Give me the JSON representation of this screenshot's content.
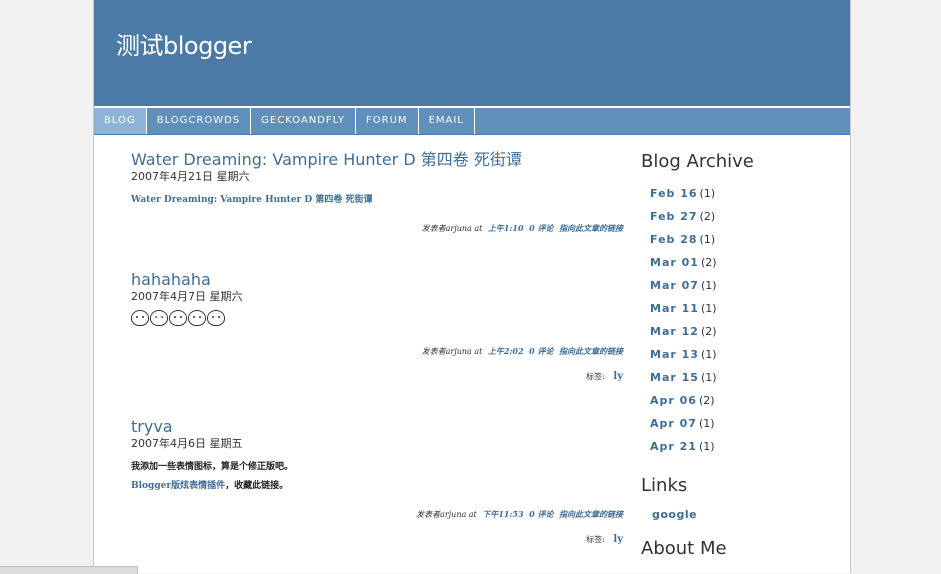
{
  "header": {
    "title": "测试blogger"
  },
  "nav": [
    "BLOG",
    "BLOGCROWDS",
    "GECKOANDFLY",
    "FORUM",
    "EMAIL"
  ],
  "posts": [
    {
      "title": "Water Dreaming: Vampire Hunter D 第四卷 死街谭",
      "date": "2007年4月21日 星期六",
      "body_link": "Water Dreaming: Vampire Hunter D 第四卷 死街谭",
      "footer_prefix": "发表者arjuna at",
      "time": "上午1:10",
      "comments": "0 评论",
      "permalink": "指向此文章的链接"
    },
    {
      "title": "hahahaha",
      "date": "2007年4月7日 星期六",
      "footer_prefix": "发表者arjuna at",
      "time": "上午2:02",
      "comments": "0 评论",
      "permalink": "指向此文章的链接",
      "labels_prefix": "标签:",
      "label": "ly"
    },
    {
      "title": "tryva",
      "date": "2007年4月6日 星期五",
      "body_text": "我添加一些表情图标，算是个修正版吧。",
      "body_link": "Blogger版炫表情插件",
      "body_text_after": "，收藏此链接。",
      "footer_prefix": "发表者arjuna at",
      "time": "下午11:53",
      "comments": "0 评论",
      "permalink": "指向此文章的链接",
      "labels_prefix": "标签:",
      "label": "ly"
    }
  ],
  "sidebar": {
    "archive_title": "Blog Archive",
    "archive": [
      {
        "date": "Feb 16",
        "count": "(1)"
      },
      {
        "date": "Feb 27",
        "count": "(2)"
      },
      {
        "date": "Feb 28",
        "count": "(1)"
      },
      {
        "date": "Mar 01",
        "count": "(2)"
      },
      {
        "date": "Mar 07",
        "count": "(1)"
      },
      {
        "date": "Mar 11",
        "count": "(1)"
      },
      {
        "date": "Mar 12",
        "count": "(2)"
      },
      {
        "date": "Mar 13",
        "count": "(1)"
      },
      {
        "date": "Mar 15",
        "count": "(1)"
      },
      {
        "date": "Apr 06",
        "count": "(2)"
      },
      {
        "date": "Apr 07",
        "count": "(1)"
      },
      {
        "date": "Apr 21",
        "count": "(1)"
      }
    ],
    "links_title": "Links",
    "links": [
      "google"
    ],
    "about_title": "About Me"
  },
  "colors": {
    "header_bg": "#4a7aa5",
    "nav_bg": "#5f8fba",
    "link": "#3d6e97"
  }
}
